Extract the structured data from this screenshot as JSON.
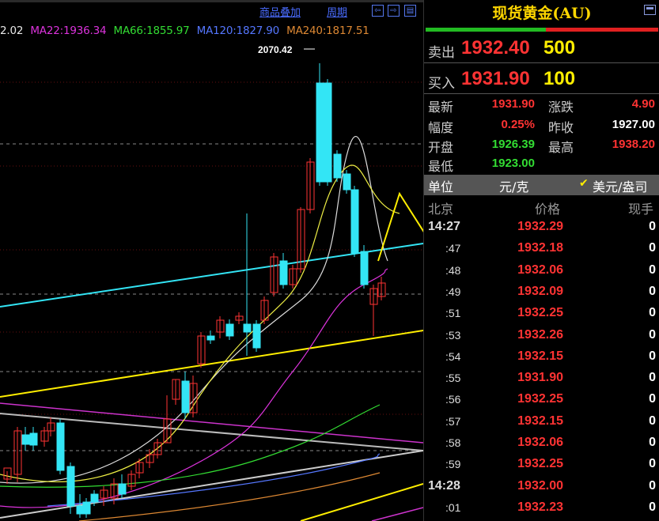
{
  "toolbar": {
    "overlay_label": "商品叠加",
    "period_label": "周期",
    "buttons": [
      "⇦",
      "⇨",
      "▤"
    ]
  },
  "ma_legend": [
    {
      "text": "2.02",
      "color": "#e8e8e8"
    },
    {
      "text": "MA22:1936.34",
      "color": "#dd33dd"
    },
    {
      "text": "MA66:1855.97",
      "color": "#33dd33"
    },
    {
      "text": "MA120:1827.90",
      "color": "#5577ff"
    },
    {
      "text": "MA240:1817.51",
      "color": "#dd8833"
    }
  ],
  "chart_data": {
    "type": "candlestick",
    "peak_label": "2070.42",
    "colors": {
      "up": "#ff3333",
      "down": "#33e5f5",
      "ma5": "#dddddd",
      "ma10": "#eeee44",
      "ma22": "#dd33dd",
      "ma66": "#33dd33",
      "ma120": "#5577ff",
      "ma240": "#dd8833",
      "support": "#ffee00",
      "channel": "#33e5f5"
    }
  },
  "panel": {
    "title": "现货黄金(AU)",
    "sell": {
      "label": "卖出",
      "price": "1932.40",
      "volume": "500"
    },
    "buy": {
      "label": "买入",
      "price": "1931.90",
      "volume": "100"
    },
    "stats": {
      "latest": {
        "label": "最新",
        "value": "1931.90"
      },
      "change": {
        "label": "涨跌",
        "value": "4.90"
      },
      "amplitude": {
        "label": "幅度",
        "value": "0.25%"
      },
      "prev_close": {
        "label": "昨收",
        "value": "1927.00"
      },
      "open": {
        "label": "开盘",
        "value": "1926.39"
      },
      "high": {
        "label": "最高",
        "value": "1938.20"
      },
      "low": {
        "label": "最低",
        "value": "1923.00"
      }
    },
    "unit": {
      "label": "单位",
      "option1": "元/克",
      "option2": "美元/盎司"
    },
    "tick_header": {
      "time": "北京",
      "price": "价格",
      "volume": "现手"
    },
    "ticks": [
      {
        "time": "14:27",
        "price": "1932.29",
        "volume": "0",
        "major": true
      },
      {
        "time": ":47",
        "price": "1932.18",
        "volume": "0",
        "major": false
      },
      {
        "time": ":48",
        "price": "1932.06",
        "volume": "0",
        "major": false
      },
      {
        "time": ":49",
        "price": "1932.09",
        "volume": "0",
        "major": false
      },
      {
        "time": ":51",
        "price": "1932.25",
        "volume": "0",
        "major": false
      },
      {
        "time": ":53",
        "price": "1932.26",
        "volume": "0",
        "major": false
      },
      {
        "time": ":54",
        "price": "1932.15",
        "volume": "0",
        "major": false
      },
      {
        "time": ":55",
        "price": "1931.90",
        "volume": "0",
        "major": false
      },
      {
        "time": ":56",
        "price": "1932.25",
        "volume": "0",
        "major": false
      },
      {
        "time": ":57",
        "price": "1932.15",
        "volume": "0",
        "major": false
      },
      {
        "time": ":58",
        "price": "1932.06",
        "volume": "0",
        "major": false
      },
      {
        "time": ":59",
        "price": "1932.25",
        "volume": "0",
        "major": false
      },
      {
        "time": "14:28",
        "price": "1932.00",
        "volume": "0",
        "major": true
      },
      {
        "time": ":01",
        "price": "1932.23",
        "volume": "0",
        "major": false
      }
    ]
  }
}
